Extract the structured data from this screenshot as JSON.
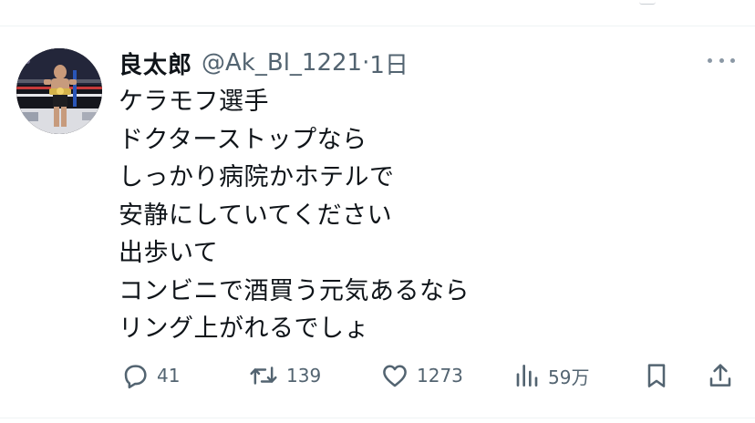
{
  "colors": {
    "text_primary": "#0f1419",
    "text_secondary": "#536471",
    "divider": "#eff3f4",
    "background": "#ffffff"
  },
  "tweet": {
    "author": {
      "display_name": "良太郎",
      "handle": "@Ak_Bl_1221",
      "separator": "·",
      "time": "1日",
      "avatar_icon": "avatar-photo-fighter"
    },
    "more_icon": "more-dots-icon",
    "text_lines": [
      "ケラモフ選手",
      "ドクターストップなら",
      "しっかり病院かホテルで",
      "安静にしていてください",
      "出歩いて",
      "コンビニで酒買う元気あるなら",
      "リング上がれるでしょ"
    ],
    "actions": {
      "reply": {
        "icon": "reply-icon",
        "count": "41"
      },
      "retweet": {
        "icon": "retweet-icon",
        "count": "139"
      },
      "like": {
        "icon": "heart-icon",
        "count": "1273"
      },
      "views": {
        "icon": "views-bar-icon",
        "count": "59万"
      },
      "bookmark": {
        "icon": "bookmark-icon"
      },
      "share": {
        "icon": "share-icon"
      }
    }
  }
}
